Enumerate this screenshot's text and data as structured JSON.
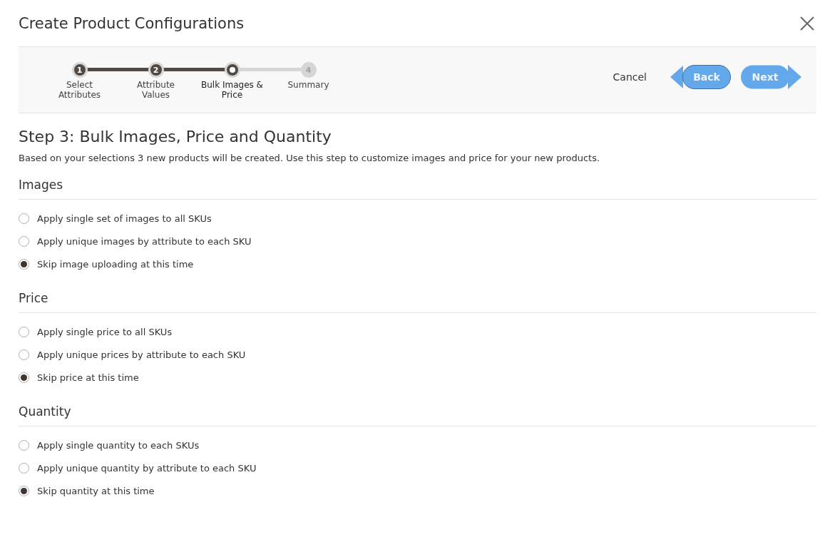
{
  "dialog": {
    "title": "Create Product Configurations"
  },
  "steps": [
    {
      "number": "1",
      "label": "Select Attributes",
      "completed": true,
      "selected": false
    },
    {
      "number": "2",
      "label": "Attribute Values",
      "completed": true,
      "selected": false
    },
    {
      "label": "Bulk Images & Price",
      "completed": false,
      "selected": true
    },
    {
      "number": "4",
      "label": "Summary",
      "completed": false,
      "selected": false
    }
  ],
  "actions": {
    "cancel": "Cancel",
    "back": "Back",
    "next": "Next"
  },
  "heading": "Step 3: Bulk Images, Price and Quantity",
  "description": "Based on your selections 3 new products will be created. Use this step to customize images and price for your new products.",
  "sections": [
    {
      "title": "Images",
      "options": [
        {
          "label": "Apply single set of images to all SKUs",
          "selected": false
        },
        {
          "label": "Apply unique images by attribute to each SKU",
          "selected": false
        },
        {
          "label": "Skip image uploading at this time",
          "selected": true
        }
      ]
    },
    {
      "title": "Price",
      "options": [
        {
          "label": "Apply single price to all SKUs",
          "selected": false
        },
        {
          "label": "Apply unique prices by attribute to each SKU",
          "selected": false
        },
        {
          "label": "Skip price at this time",
          "selected": true
        }
      ]
    },
    {
      "title": "Quantity",
      "options": [
        {
          "label": "Apply single quantity to each SKUs",
          "selected": false
        },
        {
          "label": "Apply unique quantity by attribute to each SKU",
          "selected": false
        },
        {
          "label": "Skip quantity at this time",
          "selected": true
        }
      ]
    }
  ]
}
